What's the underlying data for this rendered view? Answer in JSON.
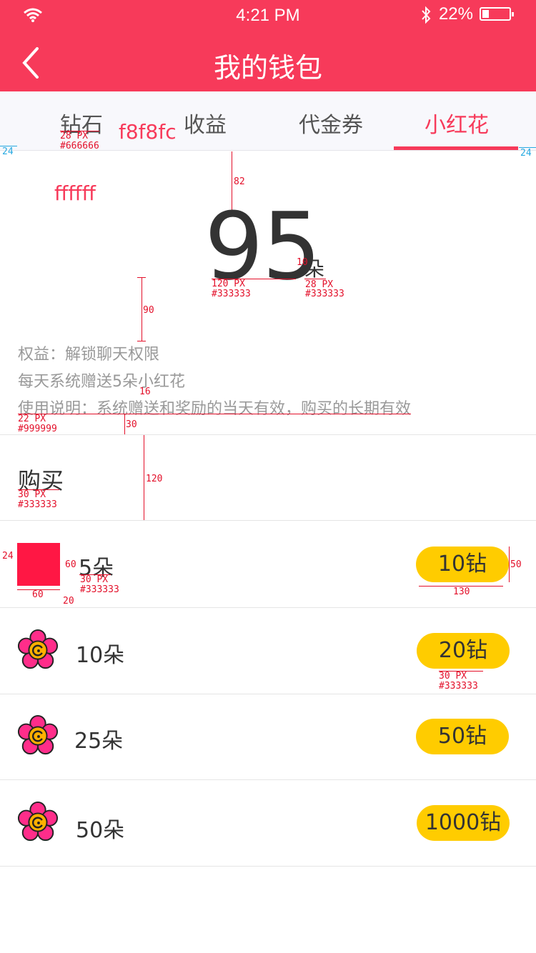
{
  "status": {
    "time": "4:21 PM",
    "battery": "22%"
  },
  "header": {
    "title": "我的钱包",
    "back_label": "‹"
  },
  "tabs": [
    {
      "label": "钻石"
    },
    {
      "label": "收益"
    },
    {
      "label": "代金券"
    },
    {
      "label": "小红花",
      "active": true
    }
  ],
  "balance": {
    "value": "95",
    "unit": "朵"
  },
  "info": {
    "line1": "权益：解锁聊天权限",
    "line2": "每天系统赠送5朵小红花",
    "line3": "使用说明：系统赠送和奖励的当天有效，购买的长期有效"
  },
  "buy": {
    "title": "购买",
    "items": [
      {
        "label": "5朵",
        "price": "10钻"
      },
      {
        "label": "10朵",
        "price": "20钻"
      },
      {
        "label": "25朵",
        "price": "50钻"
      },
      {
        "label": "50朵",
        "price": "1000钻"
      }
    ]
  },
  "annotations": {
    "tab_bg": "f8f8fc",
    "content_bg": "ffffff",
    "tab_spec": [
      "28 PX",
      "#666666"
    ],
    "num_spec": [
      "120 PX",
      "#333333"
    ],
    "unit_spec": [
      "28 PX",
      "#333333"
    ],
    "info_spec": [
      "22 PX",
      "#999999"
    ],
    "buy_spec": [
      "30 PX",
      "#333333"
    ],
    "item_spec": [
      "30 PX",
      "#333333"
    ],
    "price_spec": [
      "30 PX",
      "#333333"
    ],
    "m24": "24",
    "m82": "82",
    "m10": "10",
    "m90": "90",
    "m16": "16",
    "m30": "30",
    "m120": "120",
    "m60": "60",
    "m20": "20",
    "m50": "50",
    "m130": "130"
  },
  "colors": {
    "brand": "#f73a5a",
    "pill": "#ffcc00",
    "text": "#333333",
    "muted": "#999999"
  }
}
